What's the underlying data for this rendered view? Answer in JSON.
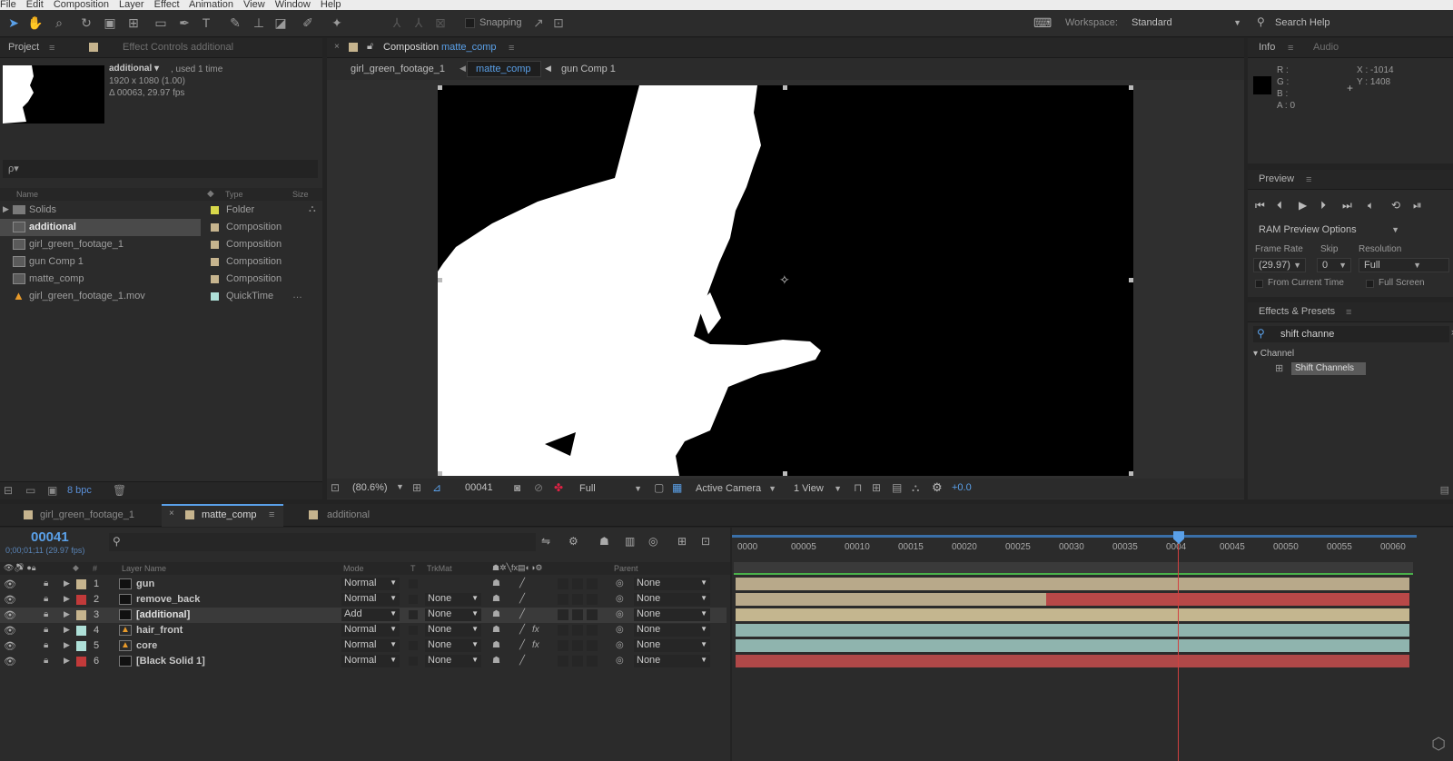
{
  "menu": [
    "File",
    "Edit",
    "Composition",
    "Layer",
    "Effect",
    "Animation",
    "View",
    "Window",
    "Help"
  ],
  "toolbar": {
    "snapping_label": "Snapping",
    "workspace_label": "Workspace:",
    "workspace_value": "Standard",
    "search_help": "Search Help"
  },
  "project_panel": {
    "tab_project": "Project",
    "tab_effect_controls": "Effect Controls additional",
    "item_name": "additional ▾",
    "item_used": ", used 1 time",
    "item_size": "1920 x 1080 (1.00)",
    "item_duration": "Δ 00063, 29.97 fps",
    "search_placeholder": "ρ▾",
    "col_name": "Name",
    "col_type": "Type",
    "col_size": "Size",
    "items": [
      {
        "name": "Solids",
        "type": "Folder",
        "color": "#d8d84a"
      },
      {
        "name": "additional",
        "type": "Composition",
        "color": "#c6b48e"
      },
      {
        "name": "girl_green_footage_1",
        "type": "Composition",
        "color": "#c6b48e"
      },
      {
        "name": "gun Comp 1",
        "type": "Composition",
        "color": "#c6b48e"
      },
      {
        "name": "matte_comp",
        "type": "Composition",
        "color": "#c6b48e"
      },
      {
        "name": "girl_green_footage_1.mov",
        "type": "QuickTime",
        "color": "#aee0d8"
      }
    ],
    "bpc": "8 bpc"
  },
  "comp_panel": {
    "tab_prefix": "Composition",
    "tab_name": "matte_comp",
    "breadcrumbs": [
      "girl_green_footage_1",
      "matte_comp",
      "gun Comp 1"
    ],
    "zoom": "(80.6%)",
    "timecode": "00041",
    "resolution": "Full",
    "camera": "Active Camera",
    "view": "1 View",
    "exposure": "+0.0"
  },
  "info_panel": {
    "tab_info": "Info",
    "tab_audio": "Audio",
    "r": "R :",
    "g": "G :",
    "b": "B :",
    "a": "A : 0",
    "x": "X : -1014",
    "y": "Y : 1408"
  },
  "preview_panel": {
    "title": "Preview",
    "ram_options": "RAM Preview Options",
    "frame_rate_label": "Frame Rate",
    "skip_label": "Skip",
    "resolution_label": "Resolution",
    "frame_rate_value": "(29.97)",
    "skip_value": "0",
    "resolution_value": "Full",
    "from_current": "From Current Time",
    "full_screen": "Full Screen"
  },
  "effects_panel": {
    "title": "Effects & Presets",
    "search_value": "shift channe",
    "category": "▾ Channel",
    "effect": "Shift Channels"
  },
  "timeline": {
    "tabs": [
      "girl_green_footage_1",
      "matte_comp",
      "additional"
    ],
    "timecode": "00041",
    "sub_timecode": "0;00;01;11 (29.97 fps)",
    "col_layer_name": "Layer Name",
    "col_mode": "Mode",
    "col_t": "T",
    "col_trkmat": "TrkMat",
    "col_parent": "Parent",
    "ruler": [
      "0000",
      "00005",
      "00010",
      "00015",
      "00020",
      "00025",
      "00030",
      "00035",
      "0004",
      "00045",
      "00050",
      "00055",
      "00060"
    ],
    "layers": [
      {
        "num": "1",
        "name": "gun",
        "mode": "Normal",
        "trkmat": "",
        "parent": "None",
        "label": "#c6b48e",
        "bar": "#b8a98a",
        "fx": false
      },
      {
        "num": "2",
        "name": "remove_back",
        "mode": "Normal",
        "trkmat": "None",
        "parent": "None",
        "label": "#c23a3a",
        "bar": "#b8a98a",
        "fx": false
      },
      {
        "num": "3",
        "name": "[additional]",
        "mode": "Add",
        "trkmat": "None",
        "parent": "None",
        "label": "#c6b48e",
        "bar": "#c4b68f",
        "fx": false
      },
      {
        "num": "4",
        "name": "hair_front",
        "mode": "Normal",
        "trkmat": "None",
        "parent": "None",
        "label": "#aee0d8",
        "bar": "#8fb4ae",
        "fx": true
      },
      {
        "num": "5",
        "name": "core",
        "mode": "Normal",
        "trkmat": "None",
        "parent": "None",
        "label": "#aee0d8",
        "bar": "#8fb4ae",
        "fx": true
      },
      {
        "num": "6",
        "name": "[Black Solid 1]",
        "mode": "Normal",
        "trkmat": "None",
        "parent": "None",
        "label": "#c23a3a",
        "bar": "#b04848",
        "fx": false
      }
    ]
  }
}
